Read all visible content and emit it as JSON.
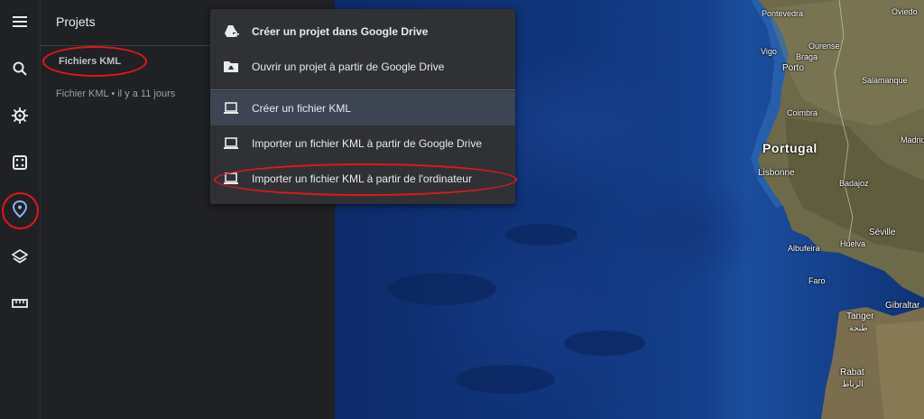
{
  "panel": {
    "title": "Projets",
    "section_label": "Fichiers KML",
    "item_label": "Fichier KML • il y a 11 jours"
  },
  "rail": {
    "icons": [
      "menu-icon",
      "search-icon",
      "voyager-icon",
      "dice-icon",
      "projects-icon",
      "layers-icon",
      "ruler-icon"
    ]
  },
  "menu": {
    "items": [
      {
        "label": "Créer un projet dans Google Drive",
        "icon": "drive-add-icon",
        "bold": true
      },
      {
        "label": "Ouvrir un projet à partir de Google Drive",
        "icon": "drive-folder-icon"
      },
      {
        "label": "Créer un fichier KML",
        "icon": "laptop-icon",
        "selected": true
      },
      {
        "label": "Importer un fichier KML à partir de Google Drive",
        "icon": "laptop-icon"
      },
      {
        "label": "Importer un fichier KML à partir de l'ordinateur",
        "icon": "laptop-icon"
      }
    ]
  },
  "map": {
    "places": [
      "Pontevedra",
      "Ourense",
      "Vigo",
      "Braga",
      "Porto",
      "Salamanque",
      "Coimbra",
      "Portugal",
      "Lisbonne",
      "Badajoz",
      "Séville",
      "Albufeira",
      "Huelva",
      "Faro",
      "Gibraltar",
      "Tanger",
      "طنجة",
      "Rabat",
      "الرباط",
      "Oviedo",
      "Madrid"
    ]
  },
  "colors": {
    "annotation": "#e3161c",
    "panel_bg": "#202124",
    "menu_bg": "#303134"
  }
}
